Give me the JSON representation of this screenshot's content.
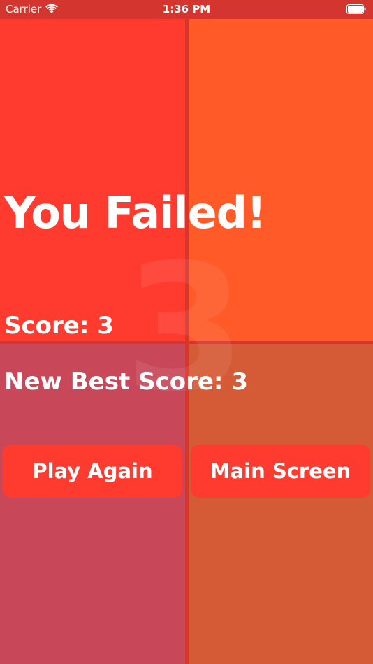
{
  "status_bar": {
    "carrier": "Carrier",
    "time": "1:36 PM",
    "wifi_icon": "wifi-icon",
    "battery_icon": "battery-icon"
  },
  "game": {
    "title": "You Failed!",
    "score_text": "Score: 3",
    "best_score_text": "New Best Score: 3",
    "background_number": "3",
    "colors": {
      "top_left": "#ff3b30",
      "top_right": "#ff5a27",
      "bottom_left": "#c8485a",
      "bottom_right": "#d55a36",
      "button": "#ff3b30"
    }
  },
  "buttons": {
    "play_again": "Play Again",
    "main_screen": "Main Screen"
  }
}
